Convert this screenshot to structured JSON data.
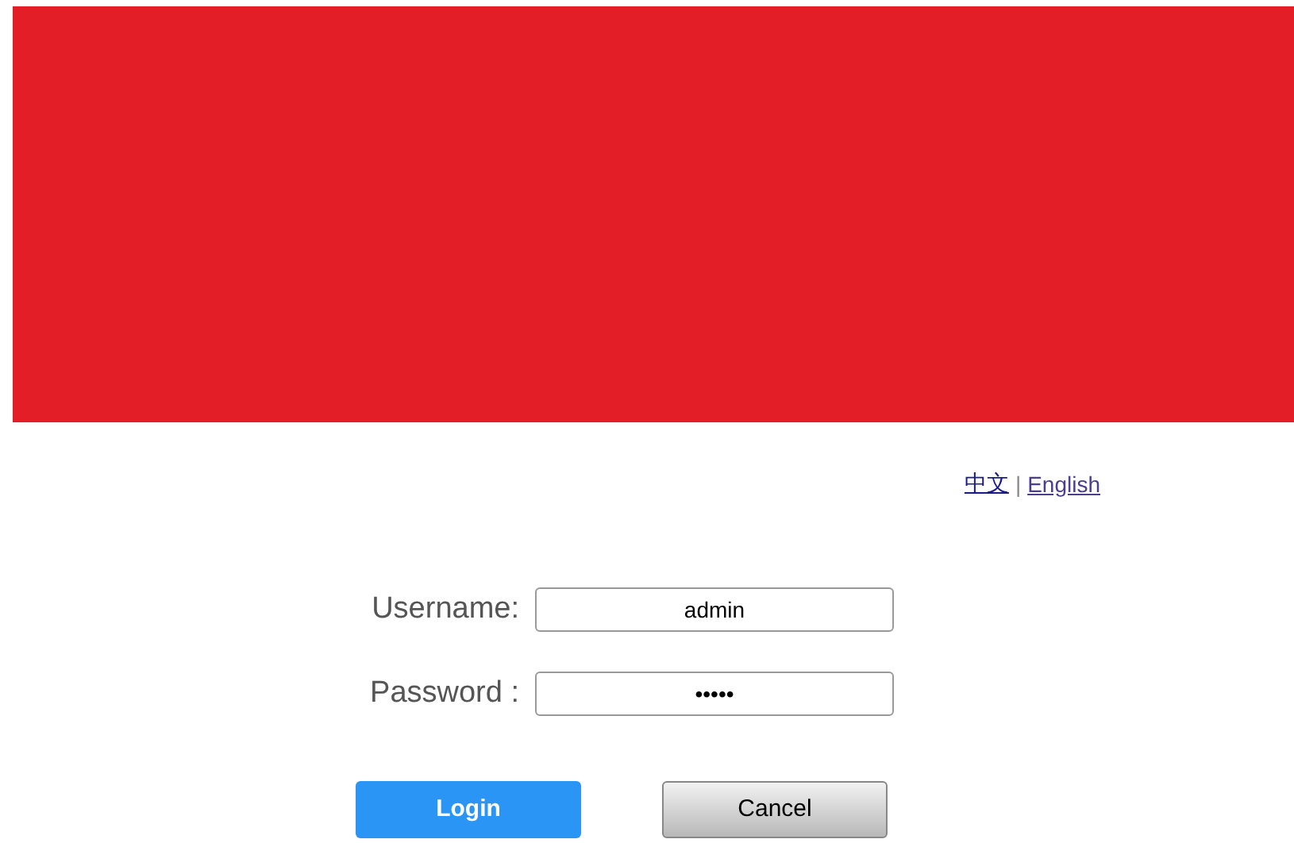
{
  "languages": [
    {
      "label": "中文"
    },
    {
      "label": "English"
    }
  ],
  "language_separator": "|",
  "form": {
    "fields": [
      {
        "label": "Username:",
        "value": "admin"
      },
      {
        "label": "Password :",
        "value": "•••••"
      }
    ],
    "buttons": [
      {
        "label": "Login",
        "kind": "primary"
      },
      {
        "label": "Cancel",
        "kind": "secondary"
      }
    ]
  }
}
